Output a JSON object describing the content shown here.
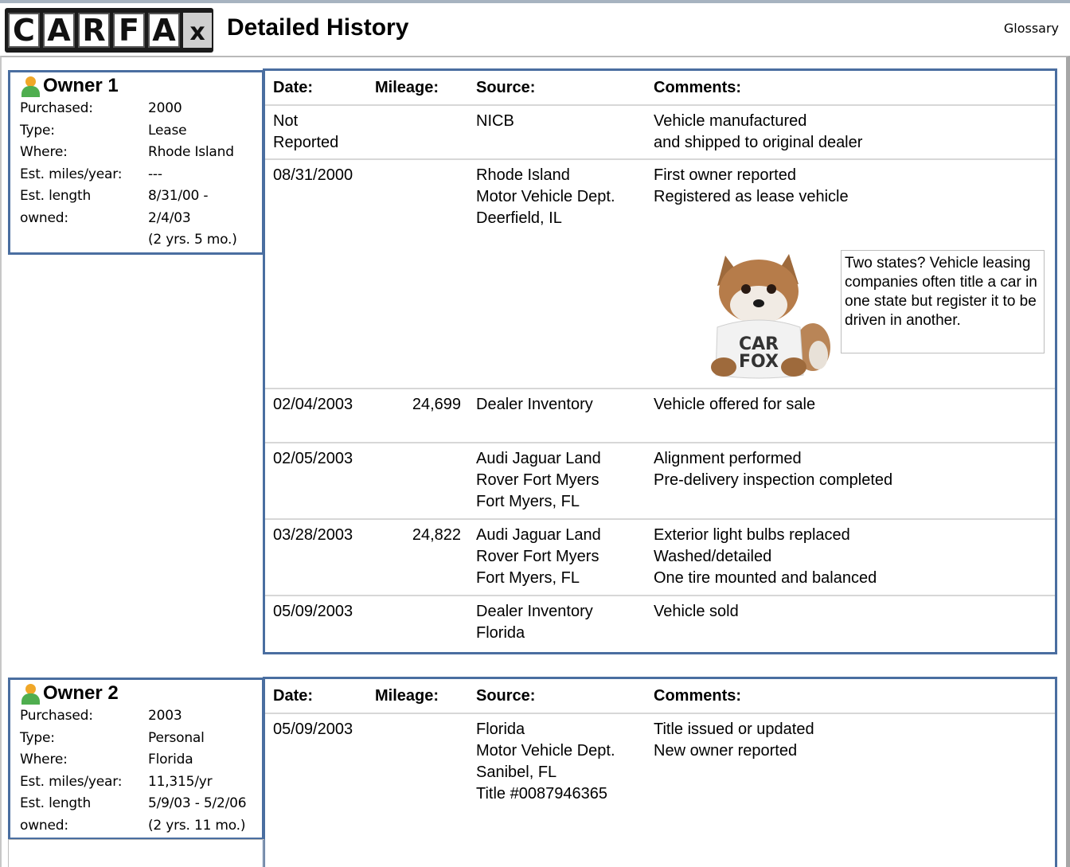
{
  "header": {
    "logo_letters": [
      "C",
      "A",
      "R",
      "F",
      "A"
    ],
    "logo_x": "x",
    "title": "Detailed History",
    "glossary": "Glossary"
  },
  "columns": {
    "date": "Date:",
    "mileage": "Mileage:",
    "source": "Source:",
    "comments": "Comments:"
  },
  "owners": [
    {
      "title": "Owner 1",
      "details": [
        {
          "k": "Purchased:",
          "v": "2000"
        },
        {
          "k": "Type:",
          "v": "Lease"
        },
        {
          "k": "Where:",
          "v": "Rhode Island"
        },
        {
          "k": "Est. miles/year:",
          "v": "---"
        },
        {
          "k": "Est. length",
          "v": "8/31/00 -"
        },
        {
          "k": "owned:",
          "v": "2/4/03"
        },
        {
          "k": "",
          "v": "(2 yrs. 5 mo.)"
        }
      ],
      "records": [
        {
          "date": [
            "Not",
            "Reported"
          ],
          "mileage": "",
          "source": [
            "NICB"
          ],
          "comments": [
            "Vehicle manufactured",
            "and shipped to original dealer"
          ]
        },
        {
          "date": [
            "08/31/2000"
          ],
          "mileage": "",
          "source": [
            "Rhode Island",
            "Motor Vehicle Dept.",
            "Deerfield, IL"
          ],
          "comments": [
            "First owner reported",
            "Registered as lease vehicle"
          ]
        },
        {
          "date": [
            "02/04/2003"
          ],
          "mileage": "24,699",
          "source": [
            "Dealer Inventory"
          ],
          "comments": [
            "Vehicle offered for sale"
          ]
        },
        {
          "date": [
            "02/05/2003"
          ],
          "mileage": "",
          "source": [
            "Audi Jaguar Land",
            "Rover Fort Myers",
            "Fort Myers, FL"
          ],
          "comments": [
            "Alignment performed",
            "Pre-delivery inspection completed"
          ]
        },
        {
          "date": [
            "03/28/2003"
          ],
          "mileage": "24,822",
          "source": [
            "Audi Jaguar Land",
            "Rover Fort Myers",
            "Fort Myers, FL"
          ],
          "comments": [
            "Exterior light bulbs replaced",
            "Washed/detailed",
            "One tire mounted and balanced"
          ]
        },
        {
          "date": [
            "05/09/2003"
          ],
          "mileage": "",
          "source": [
            "Dealer Inventory",
            "Florida"
          ],
          "comments": [
            "Vehicle sold"
          ]
        }
      ]
    },
    {
      "title": "Owner 2",
      "details": [
        {
          "k": "Purchased:",
          "v": "2003"
        },
        {
          "k": "Type:",
          "v": "Personal"
        },
        {
          "k": "Where:",
          "v": "Florida"
        },
        {
          "k": "Est. miles/year:",
          "v": "11,315/yr"
        },
        {
          "k": "Est. length",
          "v": "5/9/03 - 5/2/06"
        },
        {
          "k": "owned:",
          "v": "(2 yrs. 11 mo.)"
        }
      ],
      "records": [
        {
          "date": [
            "05/09/2003"
          ],
          "mileage": "",
          "source": [
            "Florida",
            "Motor Vehicle Dept.",
            "Sanibel, FL",
            "Title #0087946365"
          ],
          "comments": [
            "Title issued or updated",
            "New owner reported"
          ]
        }
      ]
    }
  ],
  "mascot": {
    "shirt_line1": "CAR",
    "shirt_line2": "FOX",
    "tip": "Two states? Vehicle leasing companies often title a car in one state but register it to be driven in another."
  },
  "colors": {
    "border_blue": "#4a6ea0",
    "icon_head": "#f0a728",
    "icon_body": "#4fae4f"
  }
}
